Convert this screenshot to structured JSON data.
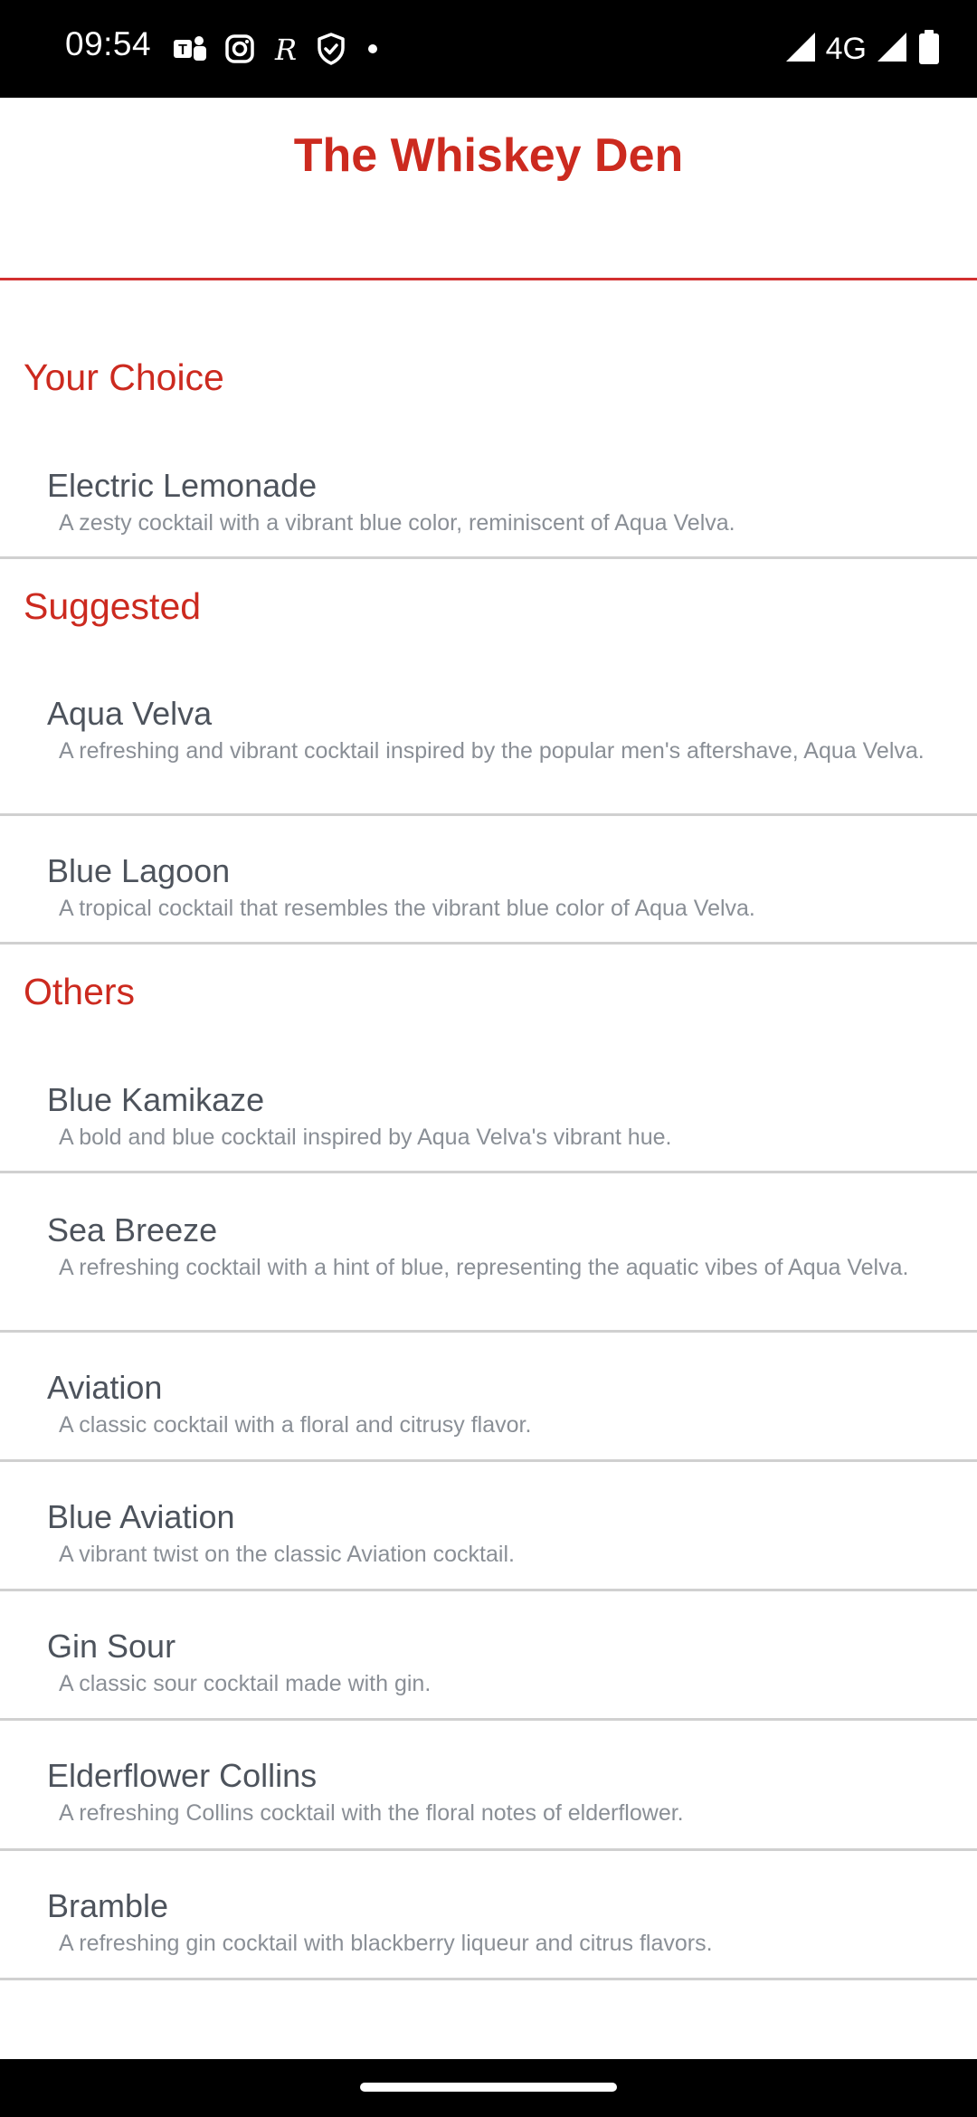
{
  "status_bar": {
    "time": "09:54",
    "network": "4G",
    "left_icons": [
      "teams-icon",
      "instagram-icon",
      "r-app-icon",
      "shield-check-icon",
      "dot-icon"
    ],
    "right_icons": [
      "signal-icon",
      "signal-icon",
      "battery-icon"
    ]
  },
  "header": {
    "title": "The Whiskey Den",
    "accent_color": "#cc2a1f"
  },
  "sections": {
    "your_choice": {
      "title": "Your Choice",
      "items": [
        {
          "name": "Electric Lemonade",
          "description": "A zesty cocktail with a vibrant blue color, reminiscent of Aqua Velva."
        }
      ]
    },
    "suggested": {
      "title": "Suggested",
      "items": [
        {
          "name": "Aqua Velva",
          "description": "A refreshing and vibrant cocktail inspired by the popular men's aftershave, Aqua Velva."
        },
        {
          "name": "Blue Lagoon",
          "description": "A tropical cocktail that resembles the vibrant blue color of Aqua Velva."
        }
      ]
    },
    "others": {
      "title": "Others",
      "items": [
        {
          "name": "Blue Kamikaze",
          "description": "A bold and blue cocktail inspired by Aqua Velva's vibrant hue."
        },
        {
          "name": "Sea Breeze",
          "description": "A refreshing cocktail with a hint of blue, representing the aquatic vibes of Aqua Velva."
        },
        {
          "name": "Aviation",
          "description": "A classic cocktail with a floral and citrusy flavor."
        },
        {
          "name": "Blue Aviation",
          "description": "A vibrant twist on the classic Aviation cocktail."
        },
        {
          "name": "Gin Sour",
          "description": "A classic sour cocktail made with gin."
        },
        {
          "name": "Elderflower Collins",
          "description": "A refreshing Collins cocktail with the floral notes of elderflower."
        },
        {
          "name": "Bramble",
          "description": "A refreshing gin cocktail with blackberry liqueur and citrus flavors."
        }
      ]
    }
  }
}
